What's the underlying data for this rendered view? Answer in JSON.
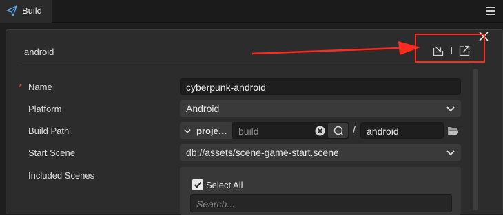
{
  "tab": {
    "title": "Build",
    "icon": "paper-plane-icon"
  },
  "header": {
    "title": "android"
  },
  "form": {
    "name": {
      "label": "Name",
      "required_mark": "*",
      "value": "cyberpunk-android"
    },
    "platform": {
      "label": "Platform",
      "value": "Android"
    },
    "build_path": {
      "label": "Build Path",
      "prefix": "proje…",
      "placeholder": "build",
      "separator": "/",
      "value": "android"
    },
    "start_scene": {
      "label": "Start Scene",
      "value": "db://assets/scene-game-start.scene"
    },
    "included_scenes": {
      "label": "Included Scenes",
      "select_all_label": "Select All",
      "select_all_checked": true,
      "search_placeholder": "Search..."
    }
  },
  "annotation": {
    "color": "#ff2a1f"
  },
  "colors": {
    "panel_bg": "#2c2c2c",
    "field_bg": "#1e1e1e",
    "select_bg": "#3a3a3a"
  }
}
